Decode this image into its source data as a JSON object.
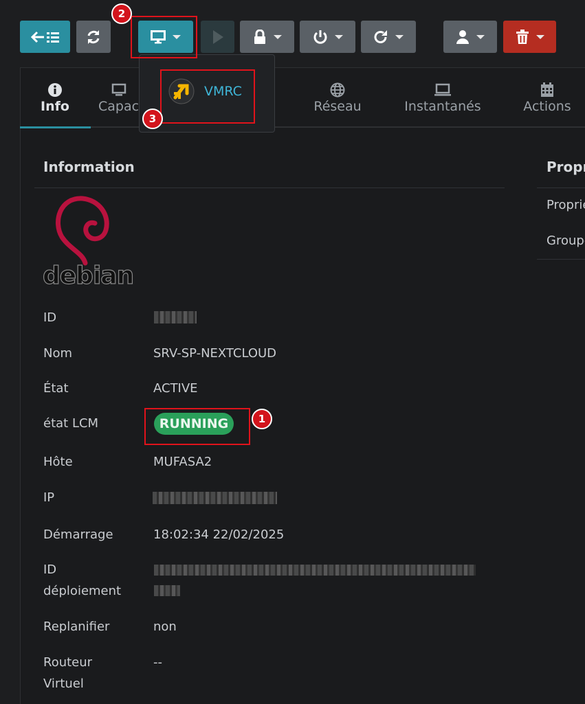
{
  "toolbar": {
    "back_icon": "arrow-left-list-icon",
    "refresh_icon": "refresh-icon",
    "console_icon": "monitor-icon",
    "play_icon": "play-icon",
    "lock_icon": "lock-icon",
    "power_icon": "power-icon",
    "reboot_icon": "reload-icon",
    "user_icon": "user-icon",
    "delete_icon": "trash-icon",
    "colors": {
      "teal": "#2a8fa0",
      "grey": "#5a6066",
      "red": "#b52d21"
    }
  },
  "dropdown": {
    "items": [
      {
        "label": "VMRC",
        "icon": "vmrc-icon"
      }
    ]
  },
  "tabs": [
    {
      "label": "Info",
      "icon": "info-icon",
      "active": true
    },
    {
      "label": "Capacité",
      "icon": "monitor-icon"
    },
    {
      "label": "Réseau",
      "icon": "globe-icon"
    },
    {
      "label": "Instantanés",
      "icon": "laptop-icon"
    },
    {
      "label": "Actions",
      "icon": "calendar-icon"
    }
  ],
  "info": {
    "title": "Information",
    "logo_text": "debian",
    "rows": [
      {
        "label": "ID",
        "value": ""
      },
      {
        "label": "Nom",
        "value": "SRV-SP-NEXTCLOUD"
      },
      {
        "label": "État",
        "value": "ACTIVE"
      },
      {
        "label": "état LCM",
        "value": "RUNNING"
      },
      {
        "label": "Hôte",
        "value": "MUFASA2"
      },
      {
        "label": "IP",
        "value": ""
      },
      {
        "label": "Démarrage",
        "value": "18:02:34 22/02/2025"
      },
      {
        "label": "ID déploiement",
        "value": ""
      },
      {
        "label": "Replanifier",
        "value": "non"
      },
      {
        "label": "Routeur Virtuel",
        "value": "--"
      }
    ]
  },
  "props": {
    "title": "Propriétés",
    "rows": [
      "Propriétaire",
      "Groupe"
    ]
  },
  "callouts": [
    "1",
    "2",
    "3"
  ]
}
